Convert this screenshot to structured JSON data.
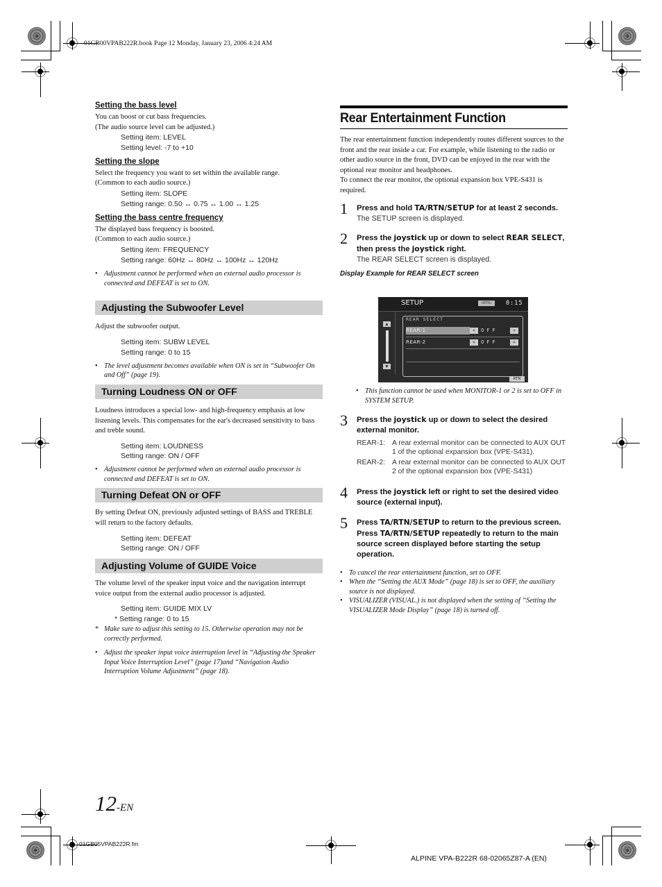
{
  "header": {
    "stamp": "01GB00VPAB222R.book  Page 12  Monday, January 23, 2006  4:24 AM"
  },
  "left": {
    "bass_level": {
      "heading": "Setting the bass level",
      "body": [
        "You can boost or cut bass frequencies.",
        "(The audio source level can be adjusted.)"
      ],
      "settings": [
        "Setting item: LEVEL",
        "Setting level: -7 to +10"
      ]
    },
    "slope": {
      "heading": "Setting the slope",
      "body": [
        "Select the frequency you want to set within the available range.",
        "(Common to each audio source.)"
      ],
      "settings": [
        "Setting item: SLOPE",
        "Setting range: 0.50 ↔ 0.75 ↔ 1.00 ↔ 1.25"
      ]
    },
    "centre_freq": {
      "heading": "Setting the bass centre frequency",
      "body": [
        "The displayed bass frequency is boosted.",
        "(Common to each audio source.)"
      ],
      "settings": [
        "Setting item: FREQUENCY",
        "Setting range: 60Hz ↔ 80Hz ↔ 100Hz ↔ 120Hz"
      ],
      "note": "Adjustment cannot be performed when an external audio processor is connected and DEFEAT is set to ON."
    },
    "subwoofer": {
      "heading": "Adjusting the Subwoofer Level",
      "body": "Adjust the subwoofer output.",
      "settings": [
        "Setting item: SUBW LEVEL",
        "Setting range: 0 to 15"
      ],
      "note": "The level adjustment becomes available when ON is set in “Subwoofer On and Off” (page 19)."
    },
    "loudness": {
      "heading": "Turning Loudness ON or OFF",
      "body": "Loudness introduces a special low- and high-frequency emphasis at low listening levels. This compensates for the ear's decreased sensitivity to bass and treble sound.",
      "settings": [
        "Setting item: LOUDNESS",
        "Setting range: ON / OFF"
      ],
      "note": "Adjustment cannot be performed when an external audio processor is connected and DEFEAT is set to ON."
    },
    "defeat": {
      "heading": "Turning Defeat ON or OFF",
      "body": "By setting Defeat ON, previously adjusted settings of BASS and TREBLE will return to the factory defaults.",
      "settings": [
        "Setting item: DEFEAT",
        "Setting range: ON / OFF"
      ]
    },
    "guide": {
      "heading": "Adjusting Volume of GUIDE Voice",
      "body": "The volume level of the speaker input voice and the navigation interrupt voice output from the external audio processor is adjusted.",
      "settings": [
        "Setting item: GUIDE MIX LV",
        "* Setting range: 0 to 15"
      ],
      "asterisk_note": "Make sure to adjust this setting to 15. Otherwise operation may not be correctly performed.",
      "note": "Adjust the speaker input voice interruption level in “Adjusting the Speaker Input Voice Interruption Level” (page 17)and “Navigation Audio Interruption Volume Adjustment” (page 18)."
    }
  },
  "right": {
    "title": "Rear Entertainment Function",
    "intro": "The rear entertainment function independently routes different sources to the front and the rear inside a car. For example, while listening to the radio or other audio source in the front, DVD can be enjoyed in the rear with the optional rear monitor and headphones.",
    "intro2": "To connect the rear monitor, the optional expansion box VPE-S431 is required.",
    "steps": [
      {
        "num": "1",
        "pre": "Press and hold ",
        "key": "TA/RTN/SETUP",
        "post": " for at least 2 seconds.",
        "result": "The SETUP screen is displayed."
      },
      {
        "num": "2",
        "pre": "Press the ",
        "key": "joystick",
        "mid": " up or down to select ",
        "key2": "REAR SELECT",
        "mid2": ", then press the ",
        "key3": "joystick",
        "post": " right.",
        "result": "The REAR SELECT screen is displayed."
      },
      {
        "num": "3",
        "pre": "Press the ",
        "key": "joystick",
        "post": " up or down to select the desired external monitor."
      },
      {
        "num": "4",
        "pre": "Press the ",
        "key": "joystick",
        "post": " left or right to set the desired video source (external input)."
      },
      {
        "num": "5",
        "pre": "Press ",
        "key": "TA/RTN/SETUP",
        "mid": " to return to the previous screen. Press ",
        "key2": "TA/RTN/SETUP",
        "post": " repeatedly to return to the main source screen displayed before starting the setup operation."
      }
    ],
    "caption": "Display Example for REAR SELECT screen",
    "screen": {
      "title": "SETUP",
      "badge": "«RTN»",
      "time": "0:15",
      "panel_title": "REAR SELECT",
      "rows": [
        {
          "label": "REAR-1",
          "value": "OFF",
          "selected": true
        },
        {
          "label": "REAR-2",
          "value": "OFF",
          "selected": false
        }
      ],
      "up_icon": "▲",
      "down_icon": "▼",
      "left_arrow": "«",
      "right_arrow": "»",
      "rtn_button": "RTN"
    },
    "screen_note": "This function cannot be used when MONITOR-1 or 2 is set to OFF in SYSTEM SETUP.",
    "defs": [
      {
        "term": "REAR-1:",
        "desc": "A rear external monitor can be connected to AUX OUT 1 of the optional expansion box (VPE-S431)."
      },
      {
        "term": "REAR-2:",
        "desc": "A rear external monitor can be connected to AUX OUT 2 of the optional expansion box (VPE-S431)"
      }
    ],
    "notes": [
      "To cancel the rear entertainment function, set to OFF.",
      "When the “Setting the AUX Mode” (page 18) is set to OFF, the auxiliary source is not displayed.",
      "VISUALIZER (VISUAL.) is not displayed when the setting of “Setting the VISUALIZER Mode Display” (page 18) is turned off."
    ]
  },
  "footer": {
    "page_number": "12",
    "page_suffix": "-EN",
    "file": "01GB05VPAB222R.fm",
    "model": "ALPINE VPA-B222R 68-02065Z87-A (EN)"
  },
  "bullet": "•",
  "asterisk": "*"
}
